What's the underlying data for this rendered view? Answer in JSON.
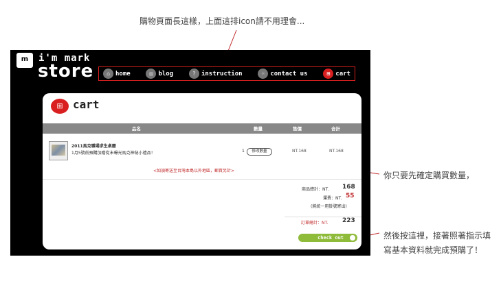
{
  "annotations": {
    "top": "購物頁面長這樣，上面這排icon請不用理會...",
    "right_qty": "你只要先確定購買數量，",
    "right_checkout": "然後按這裡，接著照著指示填寫基本資料就完成預購了！"
  },
  "brand": {
    "logo": "m",
    "line1": "i'm mark",
    "line2": "store"
  },
  "nav": [
    {
      "label": "home",
      "icon": "home-icon"
    },
    {
      "label": "blog",
      "icon": "blog-icon"
    },
    {
      "label": "instruction",
      "icon": "question-icon"
    },
    {
      "label": "contact us",
      "icon": "lightbulb-icon"
    },
    {
      "label": "cart",
      "icon": "cart-icon"
    }
  ],
  "cart": {
    "title": "cart",
    "columns": {
      "name": "品名",
      "qty": "數量",
      "price": "售價",
      "total": "合計"
    },
    "item": {
      "name": "2011馬克職場求生桌曆",
      "desc": "1月5號前預購加贈從未曝光馬克神秘小禮品！",
      "qty": "1",
      "modify_label": "修改數量",
      "price": "NT.168",
      "total": "NT.168"
    },
    "shipping_note": "<如須寄送至台灣本島以外地區，郵資另計>",
    "summary": {
      "subtotal_label": "商品總計：NT.",
      "subtotal": "168",
      "shipping_label": "運費：NT.",
      "shipping": "55",
      "shipping_note": "(將統一用掛號寄出)",
      "order_total_label": "訂單總計：NT.",
      "order_total": "223"
    },
    "checkout_label": "check out"
  },
  "colors": {
    "accent_red": "#d91f1f",
    "checkout_green": "#8fbb3a"
  }
}
